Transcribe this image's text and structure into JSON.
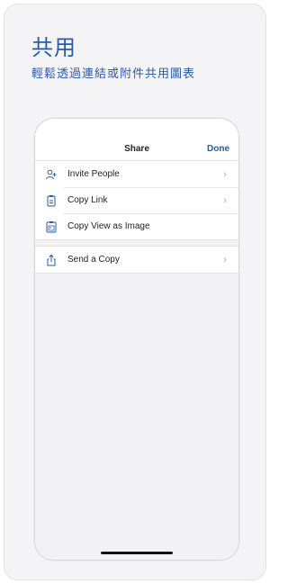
{
  "promo": {
    "headline": "共用",
    "subline": "輕鬆透過連結或附件共用圖表"
  },
  "share_sheet": {
    "title": "Share",
    "done_label": "Done",
    "groups": [
      {
        "items": [
          {
            "label": "Invite People",
            "icon": "person-add-icon",
            "chevron": "›"
          },
          {
            "label": "Copy Link",
            "icon": "clipboard-icon",
            "chevron": "›"
          },
          {
            "label": "Copy View as Image",
            "icon": "image-clipboard-icon",
            "chevron": ""
          }
        ]
      },
      {
        "items": [
          {
            "label": "Send a Copy",
            "icon": "share-icon",
            "chevron": "›"
          }
        ]
      }
    ]
  },
  "colors": {
    "accent": "#2b5aa6",
    "background": "#f4f4f6"
  }
}
